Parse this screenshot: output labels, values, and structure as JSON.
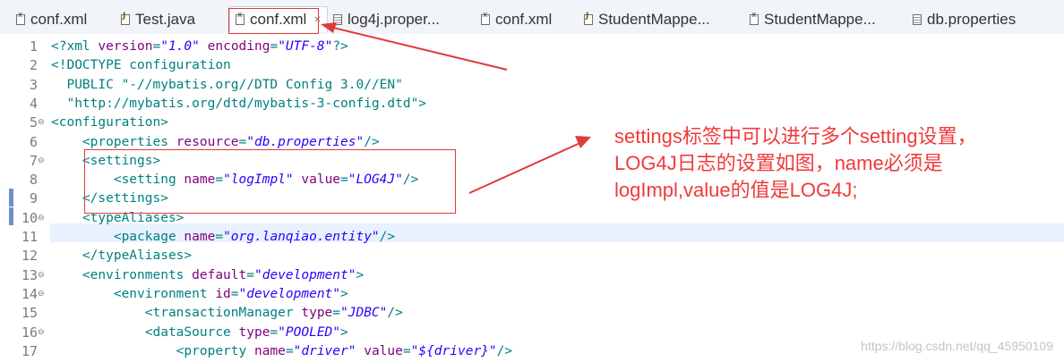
{
  "tabs": [
    {
      "label": "conf.xml",
      "icon": "xml-file-icon",
      "active": false
    },
    {
      "label": "Test.java",
      "icon": "java-file-icon",
      "active": false
    },
    {
      "label": "conf.xml",
      "icon": "xml-file-icon",
      "active": true
    },
    {
      "label": "log4j.proper...",
      "icon": "properties-file-icon",
      "active": false
    },
    {
      "label": "conf.xml",
      "icon": "xml-file-icon",
      "active": false
    },
    {
      "label": "StudentMappe...",
      "icon": "java-file-icon",
      "active": false
    },
    {
      "label": "StudentMappe...",
      "icon": "xml-file-icon",
      "active": false
    },
    {
      "label": "db.properties",
      "icon": "properties-file-icon",
      "active": false
    }
  ],
  "close_glyph": "✕",
  "lines": [
    {
      "n": "1",
      "fold": "",
      "text": "<?xml version=\"1.0\" encoding=\"UTF-8\"?>"
    },
    {
      "n": "2",
      "fold": "",
      "text": "<!DOCTYPE configuration"
    },
    {
      "n": "3",
      "fold": "",
      "text": "  PUBLIC \"-//mybatis.org//DTD Config 3.0//EN\""
    },
    {
      "n": "4",
      "fold": "",
      "text": "  \"http://mybatis.org/dtd/mybatis-3-config.dtd\">"
    },
    {
      "n": "5",
      "fold": "⊖",
      "text": "<configuration>"
    },
    {
      "n": "6",
      "fold": "",
      "text": "    <properties resource=\"db.properties\"/>"
    },
    {
      "n": "7",
      "fold": "⊖",
      "text": "    <settings>"
    },
    {
      "n": "8",
      "fold": "",
      "text": "        <setting name=\"logImpl\" value=\"LOG4J\"/>"
    },
    {
      "n": "9",
      "fold": "",
      "text": "    </settings>"
    },
    {
      "n": "10",
      "fold": "⊖",
      "text": "    <typeAliases>"
    },
    {
      "n": "11",
      "fold": "",
      "text": "        <package name=\"org.lanqiao.entity\"/>"
    },
    {
      "n": "12",
      "fold": "",
      "text": "    </typeAliases>"
    },
    {
      "n": "13",
      "fold": "⊖",
      "text": "    <environments default=\"development\">"
    },
    {
      "n": "14",
      "fold": "⊖",
      "text": "        <environment id=\"development\">"
    },
    {
      "n": "15",
      "fold": "",
      "text": "            <transactionManager type=\"JDBC\"/>"
    },
    {
      "n": "16",
      "fold": "⊖",
      "text": "            <dataSource type=\"POOLED\">"
    },
    {
      "n": "17",
      "fold": "",
      "text": "                <property name=\"driver\" value=\"${driver}\"/>"
    }
  ],
  "annotation": {
    "line1": "settings标签中可以进行多个setting设置，",
    "line2": "LOG4J日志的设置如图，name必须是",
    "line3": "logImpl,value的值是LOG4J;"
  },
  "watermark": "https://blog.csdn.net/qq_45950109",
  "colors": {
    "tag": "#008080",
    "attr_name": "#7f007f",
    "attr_value": "#2a00ff",
    "annotation_red": "#f03a3a"
  }
}
